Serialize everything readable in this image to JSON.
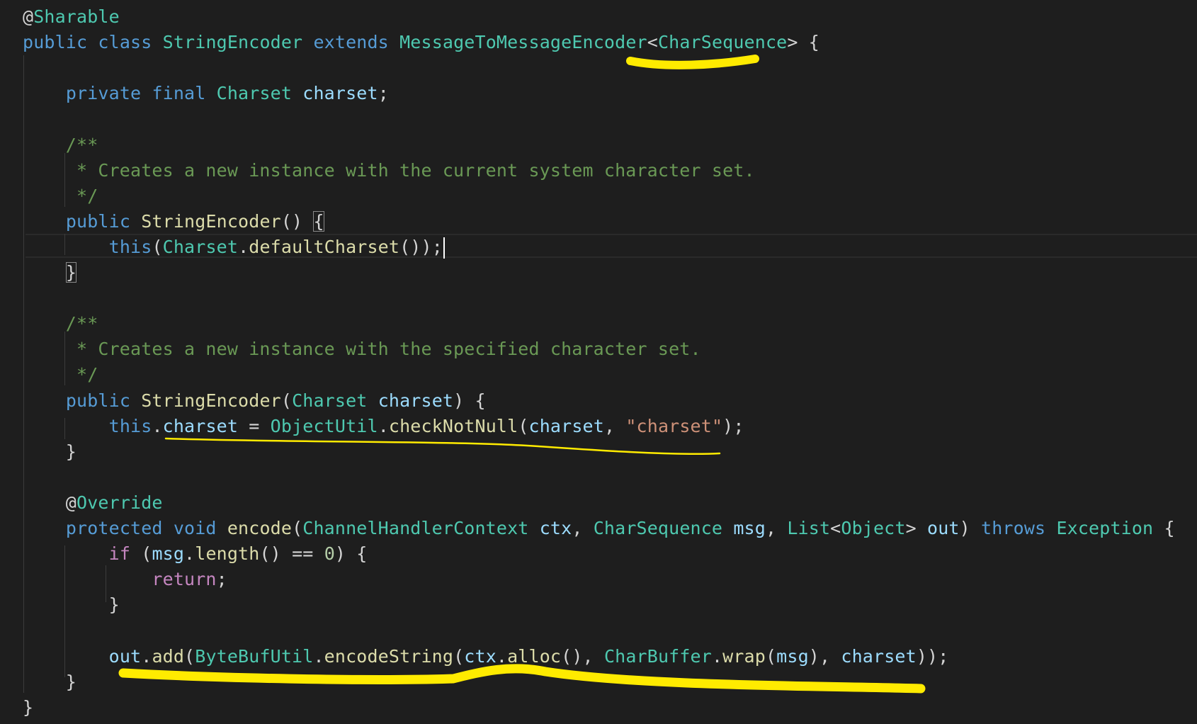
{
  "editor": {
    "lines": [
      [
        {
          "t": "@",
          "c": "pu"
        },
        {
          "t": "Sharable",
          "c": "ty"
        }
      ],
      [
        {
          "t": "public",
          "c": "kw"
        },
        {
          "t": " ",
          "c": "pu"
        },
        {
          "t": "class",
          "c": "kw"
        },
        {
          "t": " ",
          "c": "pu"
        },
        {
          "t": "StringEncoder",
          "c": "ty"
        },
        {
          "t": " ",
          "c": "pu"
        },
        {
          "t": "extends",
          "c": "kw"
        },
        {
          "t": " ",
          "c": "pu"
        },
        {
          "t": "MessageToMessageEncoder",
          "c": "ty"
        },
        {
          "t": "<",
          "c": "pu"
        },
        {
          "t": "CharSequence",
          "c": "ty"
        },
        {
          "t": "> {",
          "c": "pu"
        }
      ],
      [],
      [
        {
          "t": "    ",
          "c": "pu"
        },
        {
          "t": "private",
          "c": "kw"
        },
        {
          "t": " ",
          "c": "pu"
        },
        {
          "t": "final",
          "c": "kw"
        },
        {
          "t": " ",
          "c": "pu"
        },
        {
          "t": "Charset",
          "c": "ty"
        },
        {
          "t": " ",
          "c": "pu"
        },
        {
          "t": "charset",
          "c": "va"
        },
        {
          "t": ";",
          "c": "pu"
        }
      ],
      [],
      [
        {
          "t": "    /**",
          "c": "co"
        }
      ],
      [
        {
          "t": "     * Creates a new instance with the current system character set.",
          "c": "co"
        }
      ],
      [
        {
          "t": "     */",
          "c": "co"
        }
      ],
      [
        {
          "t": "    ",
          "c": "pu"
        },
        {
          "t": "public",
          "c": "kw"
        },
        {
          "t": " ",
          "c": "pu"
        },
        {
          "t": "StringEncoder",
          "c": "fn"
        },
        {
          "t": "() ",
          "c": "pu"
        },
        {
          "t": "{",
          "c": "pu",
          "box": true
        }
      ],
      [
        {
          "t": "        ",
          "c": "pu"
        },
        {
          "t": "this",
          "c": "kw"
        },
        {
          "t": "(",
          "c": "pu"
        },
        {
          "t": "Charset",
          "c": "ty"
        },
        {
          "t": ".",
          "c": "pu"
        },
        {
          "t": "defaultCharset",
          "c": "fn"
        },
        {
          "t": "());",
          "c": "pu"
        },
        {
          "cursor": true
        }
      ],
      [
        {
          "t": "    ",
          "c": "pu"
        },
        {
          "t": "}",
          "c": "pu",
          "box": true
        }
      ],
      [],
      [
        {
          "t": "    /**",
          "c": "co"
        }
      ],
      [
        {
          "t": "     * Creates a new instance with the specified character set.",
          "c": "co"
        }
      ],
      [
        {
          "t": "     */",
          "c": "co"
        }
      ],
      [
        {
          "t": "    ",
          "c": "pu"
        },
        {
          "t": "public",
          "c": "kw"
        },
        {
          "t": " ",
          "c": "pu"
        },
        {
          "t": "StringEncoder",
          "c": "fn"
        },
        {
          "t": "(",
          "c": "pu"
        },
        {
          "t": "Charset",
          "c": "ty"
        },
        {
          "t": " ",
          "c": "pu"
        },
        {
          "t": "charset",
          "c": "va"
        },
        {
          "t": ") {",
          "c": "pu"
        }
      ],
      [
        {
          "t": "        ",
          "c": "pu"
        },
        {
          "t": "this",
          "c": "kw"
        },
        {
          "t": ".",
          "c": "pu"
        },
        {
          "t": "charset",
          "c": "va"
        },
        {
          "t": " = ",
          "c": "pu"
        },
        {
          "t": "ObjectUtil",
          "c": "ty"
        },
        {
          "t": ".",
          "c": "pu"
        },
        {
          "t": "checkNotNull",
          "c": "fn"
        },
        {
          "t": "(",
          "c": "pu"
        },
        {
          "t": "charset",
          "c": "va"
        },
        {
          "t": ", ",
          "c": "pu"
        },
        {
          "t": "\"charset\"",
          "c": "st"
        },
        {
          "t": ");",
          "c": "pu"
        }
      ],
      [
        {
          "t": "    }",
          "c": "pu"
        }
      ],
      [],
      [
        {
          "t": "    @",
          "c": "pu"
        },
        {
          "t": "Override",
          "c": "ty"
        }
      ],
      [
        {
          "t": "    ",
          "c": "pu"
        },
        {
          "t": "protected",
          "c": "kw"
        },
        {
          "t": " ",
          "c": "pu"
        },
        {
          "t": "void",
          "c": "kw"
        },
        {
          "t": " ",
          "c": "pu"
        },
        {
          "t": "encode",
          "c": "fn"
        },
        {
          "t": "(",
          "c": "pu"
        },
        {
          "t": "ChannelHandlerContext",
          "c": "ty"
        },
        {
          "t": " ",
          "c": "pu"
        },
        {
          "t": "ctx",
          "c": "va"
        },
        {
          "t": ", ",
          "c": "pu"
        },
        {
          "t": "CharSequence",
          "c": "ty"
        },
        {
          "t": " ",
          "c": "pu"
        },
        {
          "t": "msg",
          "c": "va"
        },
        {
          "t": ", ",
          "c": "pu"
        },
        {
          "t": "List",
          "c": "ty"
        },
        {
          "t": "<",
          "c": "pu"
        },
        {
          "t": "Object",
          "c": "ty"
        },
        {
          "t": "> ",
          "c": "pu"
        },
        {
          "t": "out",
          "c": "va"
        },
        {
          "t": ") ",
          "c": "pu"
        },
        {
          "t": "throws",
          "c": "kw"
        },
        {
          "t": " ",
          "c": "pu"
        },
        {
          "t": "Exception",
          "c": "ty"
        },
        {
          "t": " {",
          "c": "pu"
        }
      ],
      [
        {
          "t": "        ",
          "c": "pu"
        },
        {
          "t": "if",
          "c": "ctl"
        },
        {
          "t": " (",
          "c": "pu"
        },
        {
          "t": "msg",
          "c": "va"
        },
        {
          "t": ".",
          "c": "pu"
        },
        {
          "t": "length",
          "c": "fn"
        },
        {
          "t": "() == ",
          "c": "pu"
        },
        {
          "t": "0",
          "c": "nu"
        },
        {
          "t": ") {",
          "c": "pu"
        }
      ],
      [
        {
          "t": "            ",
          "c": "pu"
        },
        {
          "t": "return",
          "c": "ctl"
        },
        {
          "t": ";",
          "c": "pu"
        }
      ],
      [
        {
          "t": "        }",
          "c": "pu"
        }
      ],
      [],
      [
        {
          "t": "        ",
          "c": "pu"
        },
        {
          "t": "out",
          "c": "va"
        },
        {
          "t": ".",
          "c": "pu"
        },
        {
          "t": "add",
          "c": "fn"
        },
        {
          "t": "(",
          "c": "pu"
        },
        {
          "t": "ByteBufUtil",
          "c": "ty"
        },
        {
          "t": ".",
          "c": "pu"
        },
        {
          "t": "encodeString",
          "c": "fn"
        },
        {
          "t": "(",
          "c": "pu"
        },
        {
          "t": "ctx",
          "c": "va"
        },
        {
          "t": ".",
          "c": "pu"
        },
        {
          "t": "alloc",
          "c": "fn"
        },
        {
          "t": "(), ",
          "c": "pu"
        },
        {
          "t": "CharBuffer",
          "c": "ty"
        },
        {
          "t": ".",
          "c": "pu"
        },
        {
          "t": "wrap",
          "c": "fn"
        },
        {
          "t": "(",
          "c": "pu"
        },
        {
          "t": "msg",
          "c": "va"
        },
        {
          "t": "), ",
          "c": "pu"
        },
        {
          "t": "charset",
          "c": "va"
        },
        {
          "t": "));",
          "c": "pu"
        }
      ],
      [
        {
          "t": "    }",
          "c": "pu"
        }
      ],
      [
        {
          "t": "}",
          "c": "pu"
        }
      ]
    ]
  },
  "colors": {
    "background": "#1e1e1e",
    "highlighter": "#ffeb00"
  }
}
